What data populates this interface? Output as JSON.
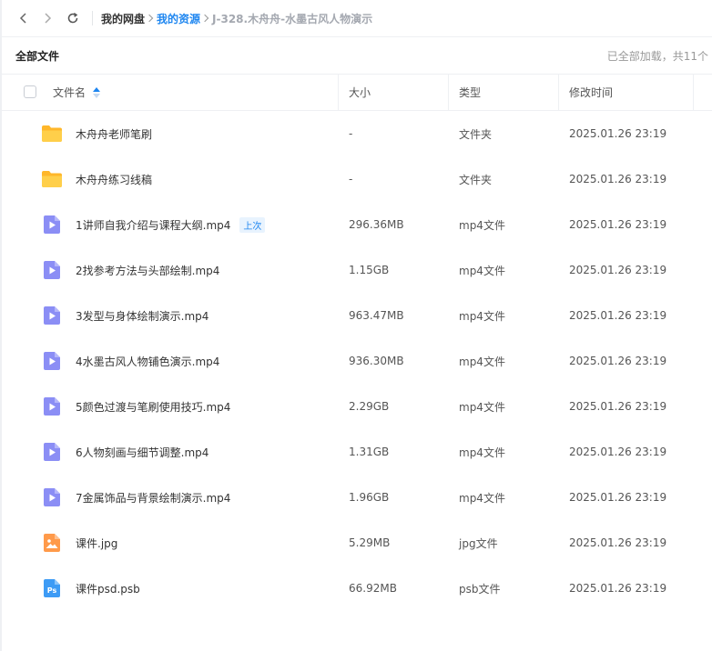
{
  "breadcrumbs": [
    "我的网盘",
    "我的资源",
    "J-328.木舟舟-水墨古风人物演示"
  ],
  "section": {
    "title": "全部文件",
    "status": "已全部加载，共11个"
  },
  "columns": {
    "name": "文件名",
    "size": "大小",
    "type": "类型",
    "modified": "修改时间"
  },
  "files": [
    {
      "name": "木舟舟老师笔刷",
      "size": "-",
      "type": "文件夹",
      "date": "2025.01.26 23:19",
      "icon": "folder-icon",
      "badge": ""
    },
    {
      "name": "木舟舟练习线稿",
      "size": "-",
      "type": "文件夹",
      "date": "2025.01.26 23:19",
      "icon": "folder-icon",
      "badge": ""
    },
    {
      "name": "1讲师自我介绍与课程大纲.mp4",
      "size": "296.36MB",
      "type": "mp4文件",
      "date": "2025.01.26 23:19",
      "icon": "video-file-icon",
      "badge": "上次"
    },
    {
      "name": "2找参考方法与头部绘制.mp4",
      "size": "1.15GB",
      "type": "mp4文件",
      "date": "2025.01.26 23:19",
      "icon": "video-file-icon",
      "badge": ""
    },
    {
      "name": "3发型与身体绘制演示.mp4",
      "size": "963.47MB",
      "type": "mp4文件",
      "date": "2025.01.26 23:19",
      "icon": "video-file-icon",
      "badge": ""
    },
    {
      "name": "4水墨古风人物铺色演示.mp4",
      "size": "936.30MB",
      "type": "mp4文件",
      "date": "2025.01.26 23:19",
      "icon": "video-file-icon",
      "badge": ""
    },
    {
      "name": "5颜色过渡与笔刷使用技巧.mp4",
      "size": "2.29GB",
      "type": "mp4文件",
      "date": "2025.01.26 23:19",
      "icon": "video-file-icon",
      "badge": ""
    },
    {
      "name": "6人物刻画与细节调整.mp4",
      "size": "1.31GB",
      "type": "mp4文件",
      "date": "2025.01.26 23:19",
      "icon": "video-file-icon",
      "badge": ""
    },
    {
      "name": "7金属饰品与背景绘制演示.mp4",
      "size": "1.96GB",
      "type": "mp4文件",
      "date": "2025.01.26 23:19",
      "icon": "video-file-icon",
      "badge": ""
    },
    {
      "name": "课件.jpg",
      "size": "5.29MB",
      "type": "jpg文件",
      "date": "2025.01.26 23:19",
      "icon": "image-file-icon",
      "badge": ""
    },
    {
      "name": "课件psd.psb",
      "size": "66.92MB",
      "type": "psb文件",
      "date": "2025.01.26 23:19",
      "icon": "photoshop-file-icon",
      "badge": ""
    }
  ],
  "colors": {
    "accent": "#1e86f0",
    "folder": "#ffc53d",
    "video": "#8b8ef5",
    "image": "#ff9a4a",
    "photoshop": "#3d9bf5"
  }
}
